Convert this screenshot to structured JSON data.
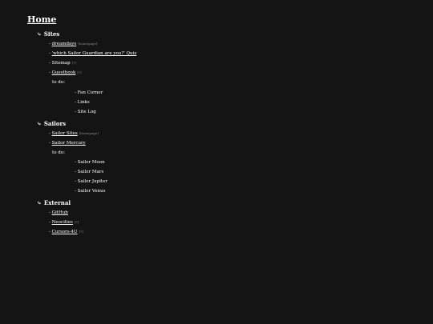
{
  "home": "Home",
  "arrow": "⤷",
  "dash": "- ",
  "sections": {
    "sites": {
      "title": "Sites",
      "items": [
        {
          "label": "dreamdays",
          "note": "[homepage]"
        },
        {
          "label": "'which Sailor Guardian are you?' Quiz",
          "note": ""
        },
        {
          "plain": "Sitemap",
          "note": "[?]"
        },
        {
          "label": "Guestbook",
          "note": "[?]"
        }
      ],
      "todo_label": "to do:",
      "todo": [
        "- Fan Corner",
        "- Links",
        "- Site Log"
      ]
    },
    "sailors": {
      "title": "Sailors",
      "items": [
        {
          "label": "Sailor Sites",
          "note": "[homepage]"
        },
        {
          "label": "Sailor Mercury",
          "note": ""
        }
      ],
      "todo_label": "to do:",
      "todo": [
        "- Sailor Moon",
        "- Sailor Mars",
        "- Sailor Jupiter",
        "- Sailor Venus"
      ]
    },
    "external": {
      "title": "External",
      "items": [
        {
          "label": "GitHub",
          "note": ""
        },
        {
          "label": "Neocities",
          "note": "[?]"
        },
        {
          "label": "Cursors-4U",
          "note": "[?]"
        }
      ]
    }
  }
}
